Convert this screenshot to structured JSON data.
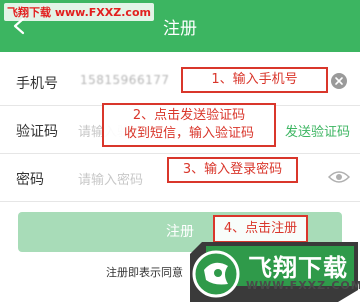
{
  "watermark_top": "飞翔下载 www.FXXZ.com",
  "header": {
    "title": "注册"
  },
  "form": {
    "phone": {
      "label": "手机号",
      "value": "15815966177"
    },
    "code": {
      "label": "验证码",
      "placeholder": "请输入验证码",
      "send_link": "发送验证码"
    },
    "password": {
      "label": "密码",
      "placeholder": "请输入密码"
    }
  },
  "callouts": {
    "step1": "1、输入手机号",
    "step2_line1": "2、点击发送验证码",
    "step2_line2": "收到短信，输入验证码",
    "step3": "3、输入登录密码",
    "step4": "4、点击注册"
  },
  "register_button": "注册",
  "agreement": "注册即表示同意",
  "logo": {
    "text": "飞翔下载",
    "url": "WWW.FXXZ.COM"
  },
  "colors": {
    "primary_green": "#3cb561",
    "disabled_green": "#a8dcb8",
    "callout_red": "#d9362b"
  }
}
